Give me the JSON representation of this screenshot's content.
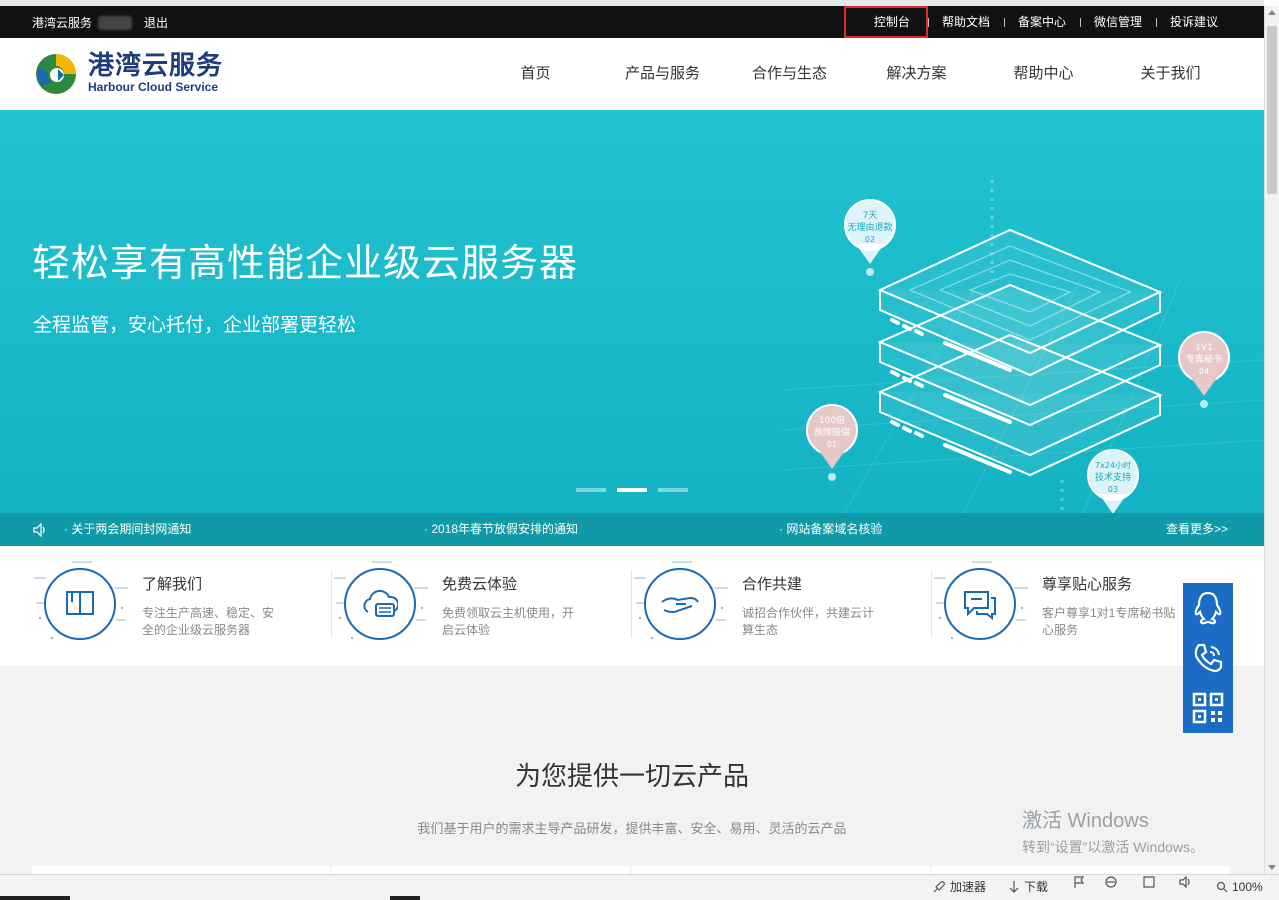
{
  "topbar": {
    "brand": "港湾云服务",
    "logout": "退出",
    "links": [
      "控制台",
      "帮助文档",
      "备案中心",
      "微信管理",
      "投诉建议"
    ]
  },
  "header": {
    "logo_cn": "港湾云服务",
    "logo_en": "Harbour Cloud Service",
    "nav": [
      "首页",
      "产品与服务",
      "合作与生态",
      "解决方案",
      "帮助中心",
      "关于我们"
    ]
  },
  "hero": {
    "title": "轻松享有高性能企业级云服务器",
    "subtitle": "全程监管，安心托付，企业部署更轻松",
    "slide_count": 3,
    "active_slide": 2,
    "pins": [
      {
        "l1": "7天",
        "l2": "无理由退款",
        "num": "02"
      },
      {
        "l1": "1V1",
        "l2": "专席秘书",
        "num": "04"
      },
      {
        "l1": "100倍",
        "l2": "故障赔偿",
        "num": "01"
      },
      {
        "l1": "7x24小时",
        "l2": "技术支持",
        "num": "03"
      }
    ]
  },
  "notices": {
    "items": [
      "· 关于两会期间封网通知",
      "· 2018年春节放假安排的通知",
      "· 网站备案域名核验"
    ],
    "more": "查看更多>>"
  },
  "features": [
    {
      "title": "了解我们",
      "desc": "专注生产高速、稳定、安全的企业级云服务器",
      "icon": "book-icon"
    },
    {
      "title": "免费云体验",
      "desc": "免费领取云主机使用，开启云体验",
      "icon": "cloud-server-icon"
    },
    {
      "title": "合作共建",
      "desc": "诚招合作伙伴，共建云计算生态",
      "icon": "handshake-icon"
    },
    {
      "title": "尊享贴心服务",
      "desc": "客户尊享1对1专席秘书贴心服务",
      "icon": "chat-icon"
    }
  ],
  "section": {
    "title": "为您提供一切云产品",
    "subtitle": "我们基于用户的需求主导产品研发，提供丰富、安全、易用、灵活的云产品"
  },
  "watermark": {
    "line1": "激活 Windows",
    "line2": "转到“设置”以激活 Windows。"
  },
  "statusbar": {
    "accelerator": "加速器",
    "download": "下载",
    "zoom": "100%"
  },
  "colors": {
    "hero": "#1bbacb",
    "notice": "#109aa8",
    "brand_blue": "#1a69b3",
    "float_panel": "#1a6cc5",
    "highlight_box": "#e02b2b"
  }
}
